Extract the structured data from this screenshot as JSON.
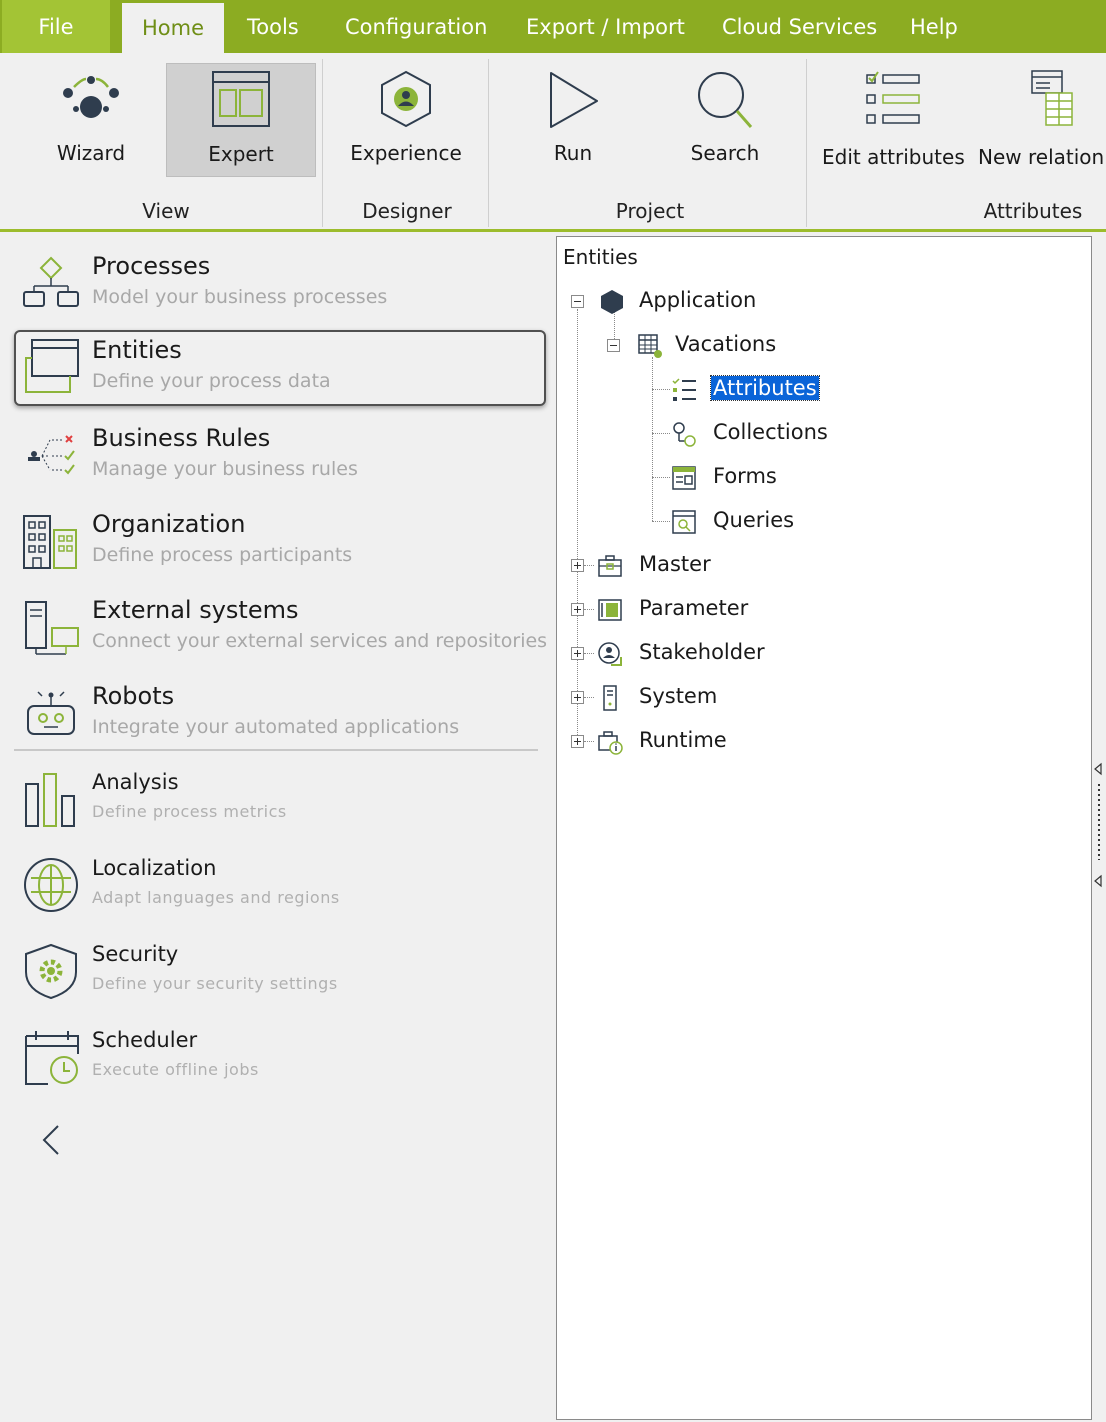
{
  "menu": {
    "file": "File",
    "items": [
      "Home",
      "Tools",
      "Configuration",
      "Export / Import",
      "Cloud Services",
      "Help"
    ]
  },
  "ribbon": {
    "groups": {
      "view": "View",
      "designer": "Designer",
      "project": "Project",
      "attributes": "Attributes"
    },
    "buttons": {
      "wizard": "Wizard",
      "expert": "Expert",
      "experience": "Experience",
      "run": "Run",
      "search": "Search",
      "edit_attributes": "Edit attributes",
      "new_relation": "New relation"
    }
  },
  "nav": {
    "items": [
      {
        "title": "Processes",
        "desc": "Model your business processes"
      },
      {
        "title": "Entities",
        "desc": "Define your process data"
      },
      {
        "title": "Business Rules",
        "desc": "Manage your business rules"
      },
      {
        "title": "Organization",
        "desc": "Define process participants"
      },
      {
        "title": "External systems",
        "desc": "Connect your external services and repositories"
      },
      {
        "title": "Robots",
        "desc": "Integrate your automated applications"
      },
      {
        "title": "Analysis",
        "desc": "Define  process  metrics"
      },
      {
        "title": "Localization",
        "desc": "Adapt  languages  and  regions"
      },
      {
        "title": "Security",
        "desc": "Define  your  security  settings"
      },
      {
        "title": "Scheduler",
        "desc": "Execute  offline  jobs"
      }
    ]
  },
  "tree": {
    "root": "Entities",
    "application": "Application",
    "vacations": "Vacations",
    "attributes": "Attributes",
    "collections": "Collections",
    "forms": "Forms",
    "queries": "Queries",
    "master": "Master",
    "parameter": "Parameter",
    "stakeholder": "Stakeholder",
    "system": "System",
    "runtime": "Runtime"
  },
  "colors": {
    "brand_green": "#8cac22",
    "file_green": "#a3c435",
    "selection_blue": "#0a64d8",
    "icon_dark": "#2f3d4e",
    "icon_green": "#8cb43a"
  }
}
